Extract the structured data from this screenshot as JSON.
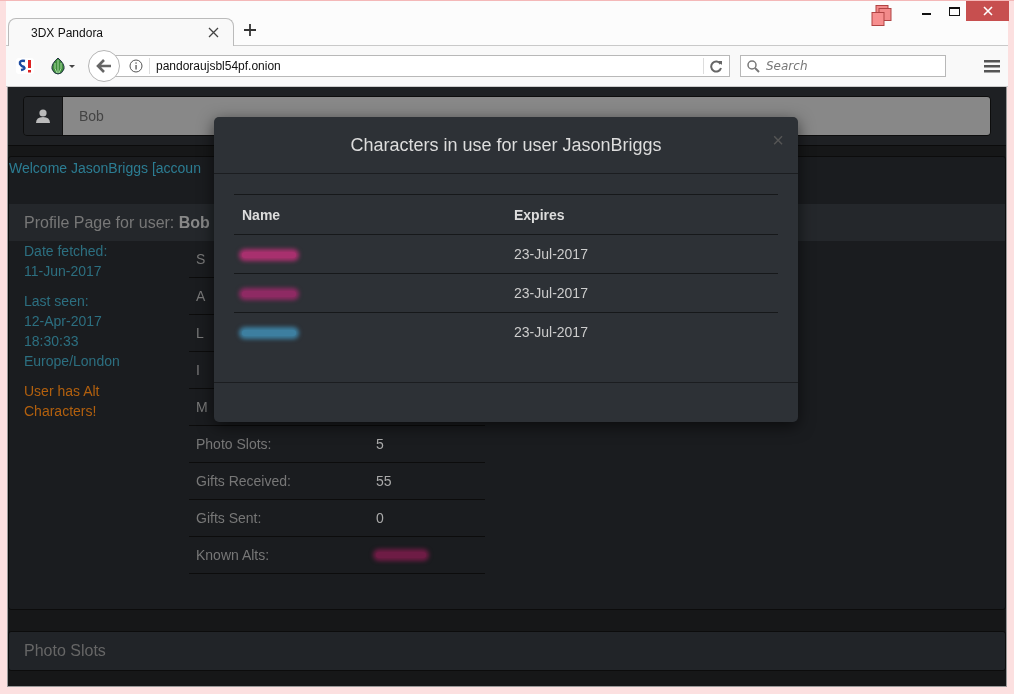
{
  "browser": {
    "tab_title": "3DX Pandora",
    "address": "pandoraujsbl54pf.onion",
    "search_placeholder": "Search"
  },
  "navbar": {
    "search_value": "Bob"
  },
  "welcome": "Welcome JasonBriggs [accoun",
  "profile": {
    "heading": "Profile Page for user: **Bob**",
    "info_blocks": [
      {
        "kind": "info",
        "lines": [
          "Date fetched:",
          "11-Jun-2017"
        ]
      },
      {
        "kind": "info",
        "lines": [
          "Last seen:",
          "12-Apr-2017",
          "18:30:33",
          "Europe/London"
        ]
      },
      {
        "kind": "warning",
        "lines": [
          "User has Alt",
          "Characters!"
        ]
      }
    ],
    "stats": [
      {
        "label": "S"
      },
      {
        "label": "A"
      },
      {
        "label": "L"
      },
      {
        "label": "I"
      },
      {
        "label": "M"
      },
      {
        "label": "Photo Slots:",
        "value": "5"
      },
      {
        "label": "Gifts Received:",
        "value": "55"
      },
      {
        "label": "Gifts Sent:",
        "value": "0"
      },
      {
        "label": "Known Alts:",
        "color": "#6e1c45"
      }
    ]
  },
  "photo_panel": {
    "heading": "Photo Slots"
  },
  "modal": {
    "title": "Characters in use for user JasonBriggs",
    "close": "×",
    "columns": [
      "Name",
      "Expires"
    ],
    "rows": [
      {
        "color": "#a8306e",
        "expires": "23-Jul-2017"
      },
      {
        "color": "#8e2a63",
        "expires": "23-Jul-2017"
      },
      {
        "color": "#3d7fa0",
        "expires": "23-Jul-2017"
      }
    ]
  }
}
